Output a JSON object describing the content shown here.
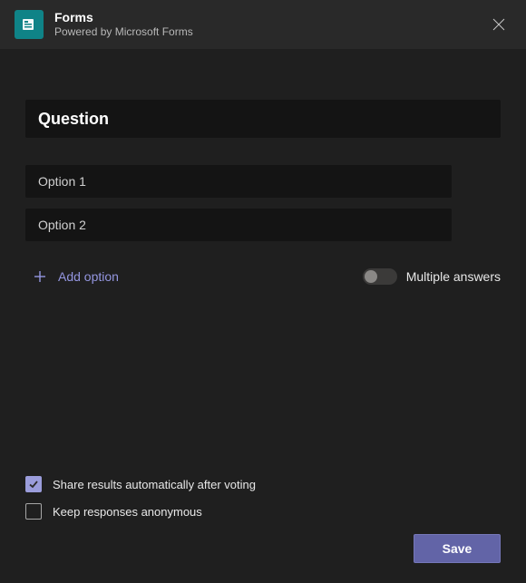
{
  "header": {
    "title": "Forms",
    "subtitle": "Powered by Microsoft Forms"
  },
  "question": {
    "placeholder": "Question",
    "value": ""
  },
  "options": [
    {
      "placeholder": "Option 1",
      "value": ""
    },
    {
      "placeholder": "Option 2",
      "value": ""
    }
  ],
  "add_option_label": "Add option",
  "multiple_answers": {
    "label": "Multiple answers",
    "on": false
  },
  "settings": {
    "share_results": {
      "label": "Share results automatically after voting",
      "checked": true
    },
    "anonymous": {
      "label": "Keep responses anonymous",
      "checked": false
    }
  },
  "save_label": "Save"
}
